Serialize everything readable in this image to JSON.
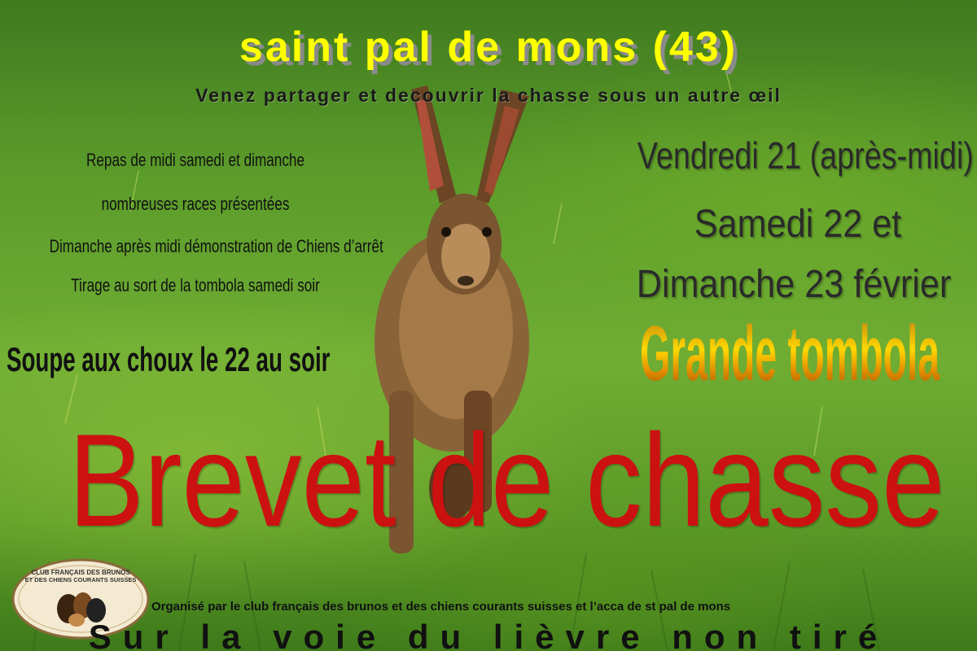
{
  "poster": {
    "title": "saint pal de mons (43)",
    "subtitle": "Venez partager et decouvrir la chasse sous un autre œil",
    "activities": [
      "Repas de midi samedi et dimanche",
      "nombreuses races présentées",
      "Dimanche après midi démonstration de Chiens d’arrêt",
      "Tirage au sort de la tombola samedi soir"
    ],
    "soupe": "Soupe aux choux le 22 au soir",
    "dates": [
      "Vendredi 21 (après-midi)",
      "Samedi 22 et",
      "Dimanche 23 février"
    ],
    "tombola": "Grande tombola",
    "main_heading": "Brevet de chasse",
    "organizer": "Organisé par le club français des brunos et des chiens courants suisses et l’acca de st pal de mons",
    "tagline": "Sur la voie du lièvre non tiré",
    "logo": {
      "text_top_1": "CLUB FRANÇAIS DES BRUNOS",
      "text_top_2": "ET DES CHIENS COURANTS SUISSES"
    },
    "colors": {
      "title": "#ffff00",
      "main_heading": "#cc1111",
      "tombola_gold": "#ffd700",
      "grass": "#6fad33"
    }
  }
}
